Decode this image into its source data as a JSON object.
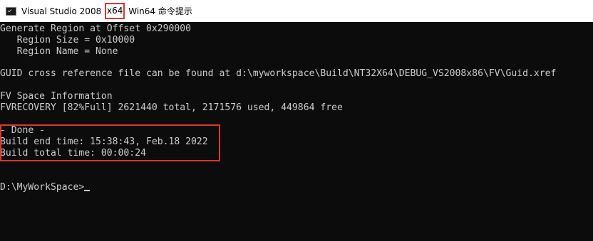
{
  "titlebar": {
    "title_before": "Visual Studio 2008 ",
    "title_highlight": "x64",
    "title_after": " Win64 命令提示"
  },
  "console": {
    "lines": [
      "Generate Region at Offset 0x290000",
      "   Region Size = 0x10000",
      "   Region Name = None",
      "",
      "GUID cross reference file can be found at d:\\myworkspace\\Build\\NT32X64\\DEBUG_VS2008x86\\FV\\Guid.xref",
      "",
      "FV Space Information",
      "FVRECOVERY [82%Full] 2621440 total, 2171576 used, 449864 free",
      "",
      "- Done -",
      "Build end time: 15:38:43, Feb.18 2022",
      "Build total time: 00:00:24",
      "",
      "",
      "D:\\MyWorkSpace>"
    ]
  },
  "colors": {
    "console_bg": "#0c0c0c",
    "console_fg": "#cccccc",
    "highlight": "#e0352f",
    "titlebar_bg": "#ffffff"
  },
  "icons": {
    "app": "console-icon"
  }
}
